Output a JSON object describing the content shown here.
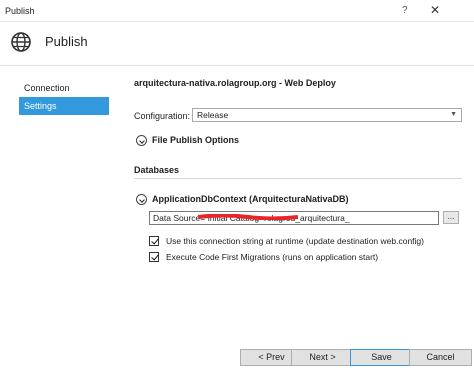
{
  "window": {
    "title": "Publish",
    "help_glyph": "?",
    "close_glyph": "✕"
  },
  "header": {
    "title": "Publish",
    "icon": "globe-icon"
  },
  "sidebar": {
    "items": [
      {
        "label": "Connection",
        "selected": false
      },
      {
        "label": "Settings",
        "selected": true
      }
    ]
  },
  "main": {
    "deploy_title": "arquitectura-nativa.rolagroup.org - Web Deploy",
    "configuration": {
      "label": "Configuration:",
      "value": "Release"
    },
    "file_publish_options": {
      "label": "File Publish Options"
    },
    "databases": {
      "label": "Databases",
      "context_label": "ApplicationDbContext (ArquitecturaNativaDB)",
      "connection_string": "Data Source=                                   Initial Catalog=rolagrou_arquitectura_",
      "ellipsis_label": "...",
      "redaction_color": "#e8262a",
      "options": [
        {
          "label": "Use this connection string at runtime (update destination web.config)",
          "checked": true
        },
        {
          "label": "Execute Code First Migrations (runs on application start)",
          "checked": true
        }
      ]
    }
  },
  "footer": {
    "prev_label": "< Prev",
    "next_label": "Next >",
    "save_label": "Save",
    "cancel_label": "Cancel"
  },
  "colors": {
    "accent": "#3399dd",
    "selected_text": "#ffffff"
  }
}
